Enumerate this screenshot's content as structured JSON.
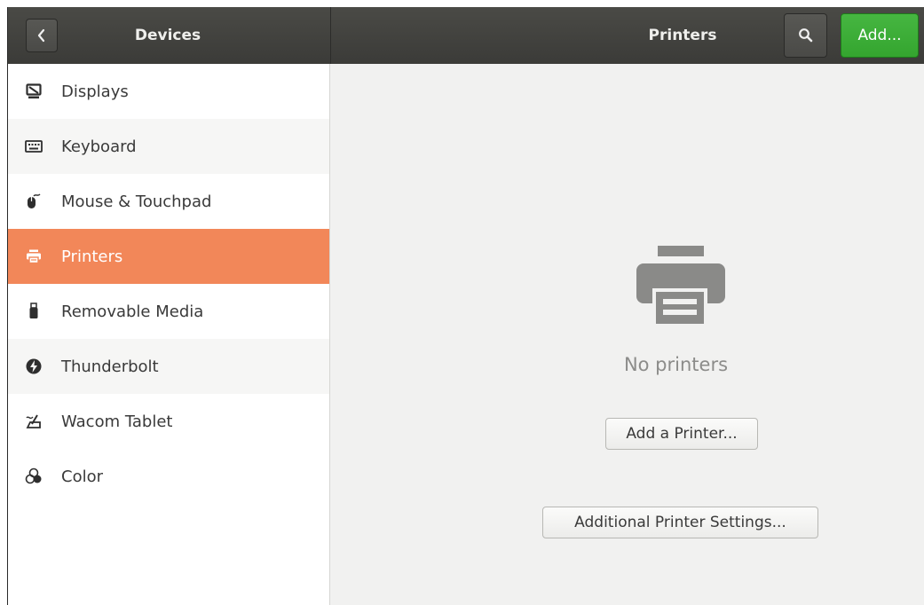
{
  "header": {
    "left_title": "Devices",
    "right_title": "Printers",
    "add_label": "Add..."
  },
  "sidebar": {
    "items": [
      {
        "label": "Displays",
        "icon": "display-icon"
      },
      {
        "label": "Keyboard",
        "icon": "keyboard-icon"
      },
      {
        "label": "Mouse & Touchpad",
        "icon": "mouse-icon"
      },
      {
        "label": "Printers",
        "icon": "printer-icon",
        "selected": true
      },
      {
        "label": "Removable Media",
        "icon": "usb-drive-icon"
      },
      {
        "label": "Thunderbolt",
        "icon": "thunderbolt-icon"
      },
      {
        "label": "Wacom Tablet",
        "icon": "tablet-icon"
      },
      {
        "label": "Color",
        "icon": "color-icon"
      }
    ]
  },
  "main": {
    "empty_text": "No printers",
    "add_printer_label": "Add a Printer...",
    "additional_settings_label": "Additional Printer Settings..."
  },
  "colors": {
    "selected": "#f28759",
    "add_button": "#3aab35",
    "header": "#434340"
  }
}
